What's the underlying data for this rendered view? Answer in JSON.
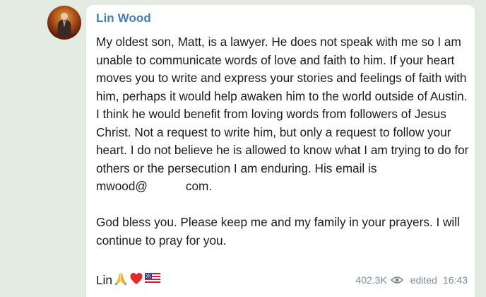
{
  "post": {
    "sender": "Lin Wood",
    "paragraph1": "My oldest son, Matt, is a lawyer. He does not speak with me so I am unable to communicate words of love and faith to him. If your heart moves you to write and express your stories and feelings of faith with him, perhaps it would help awaken him to the world outside of Austin. I think he would benefit from loving words from followers of Jesus Christ. Not a request to write him, but only a request to follow your heart. I do not believe he is allowed to know what I am trying to do for others or the persecution I am enduring. His email is",
    "email_prefix": "mwood@",
    "email_suffix": "com.",
    "paragraph2": "God bless you. Please keep me and my family in your prayers. I will continue to pray for you.",
    "signature": "Lin",
    "signature_emojis": [
      "praying-hands",
      "red-heart",
      "us-flag"
    ]
  },
  "meta": {
    "views": "402.3K",
    "edited_label": "edited",
    "time": "16:43"
  },
  "colors": {
    "background": "#e4ebe3",
    "bubble": "#ffffff",
    "sender": "#3f7fb4",
    "meta": "#7d8b99"
  }
}
